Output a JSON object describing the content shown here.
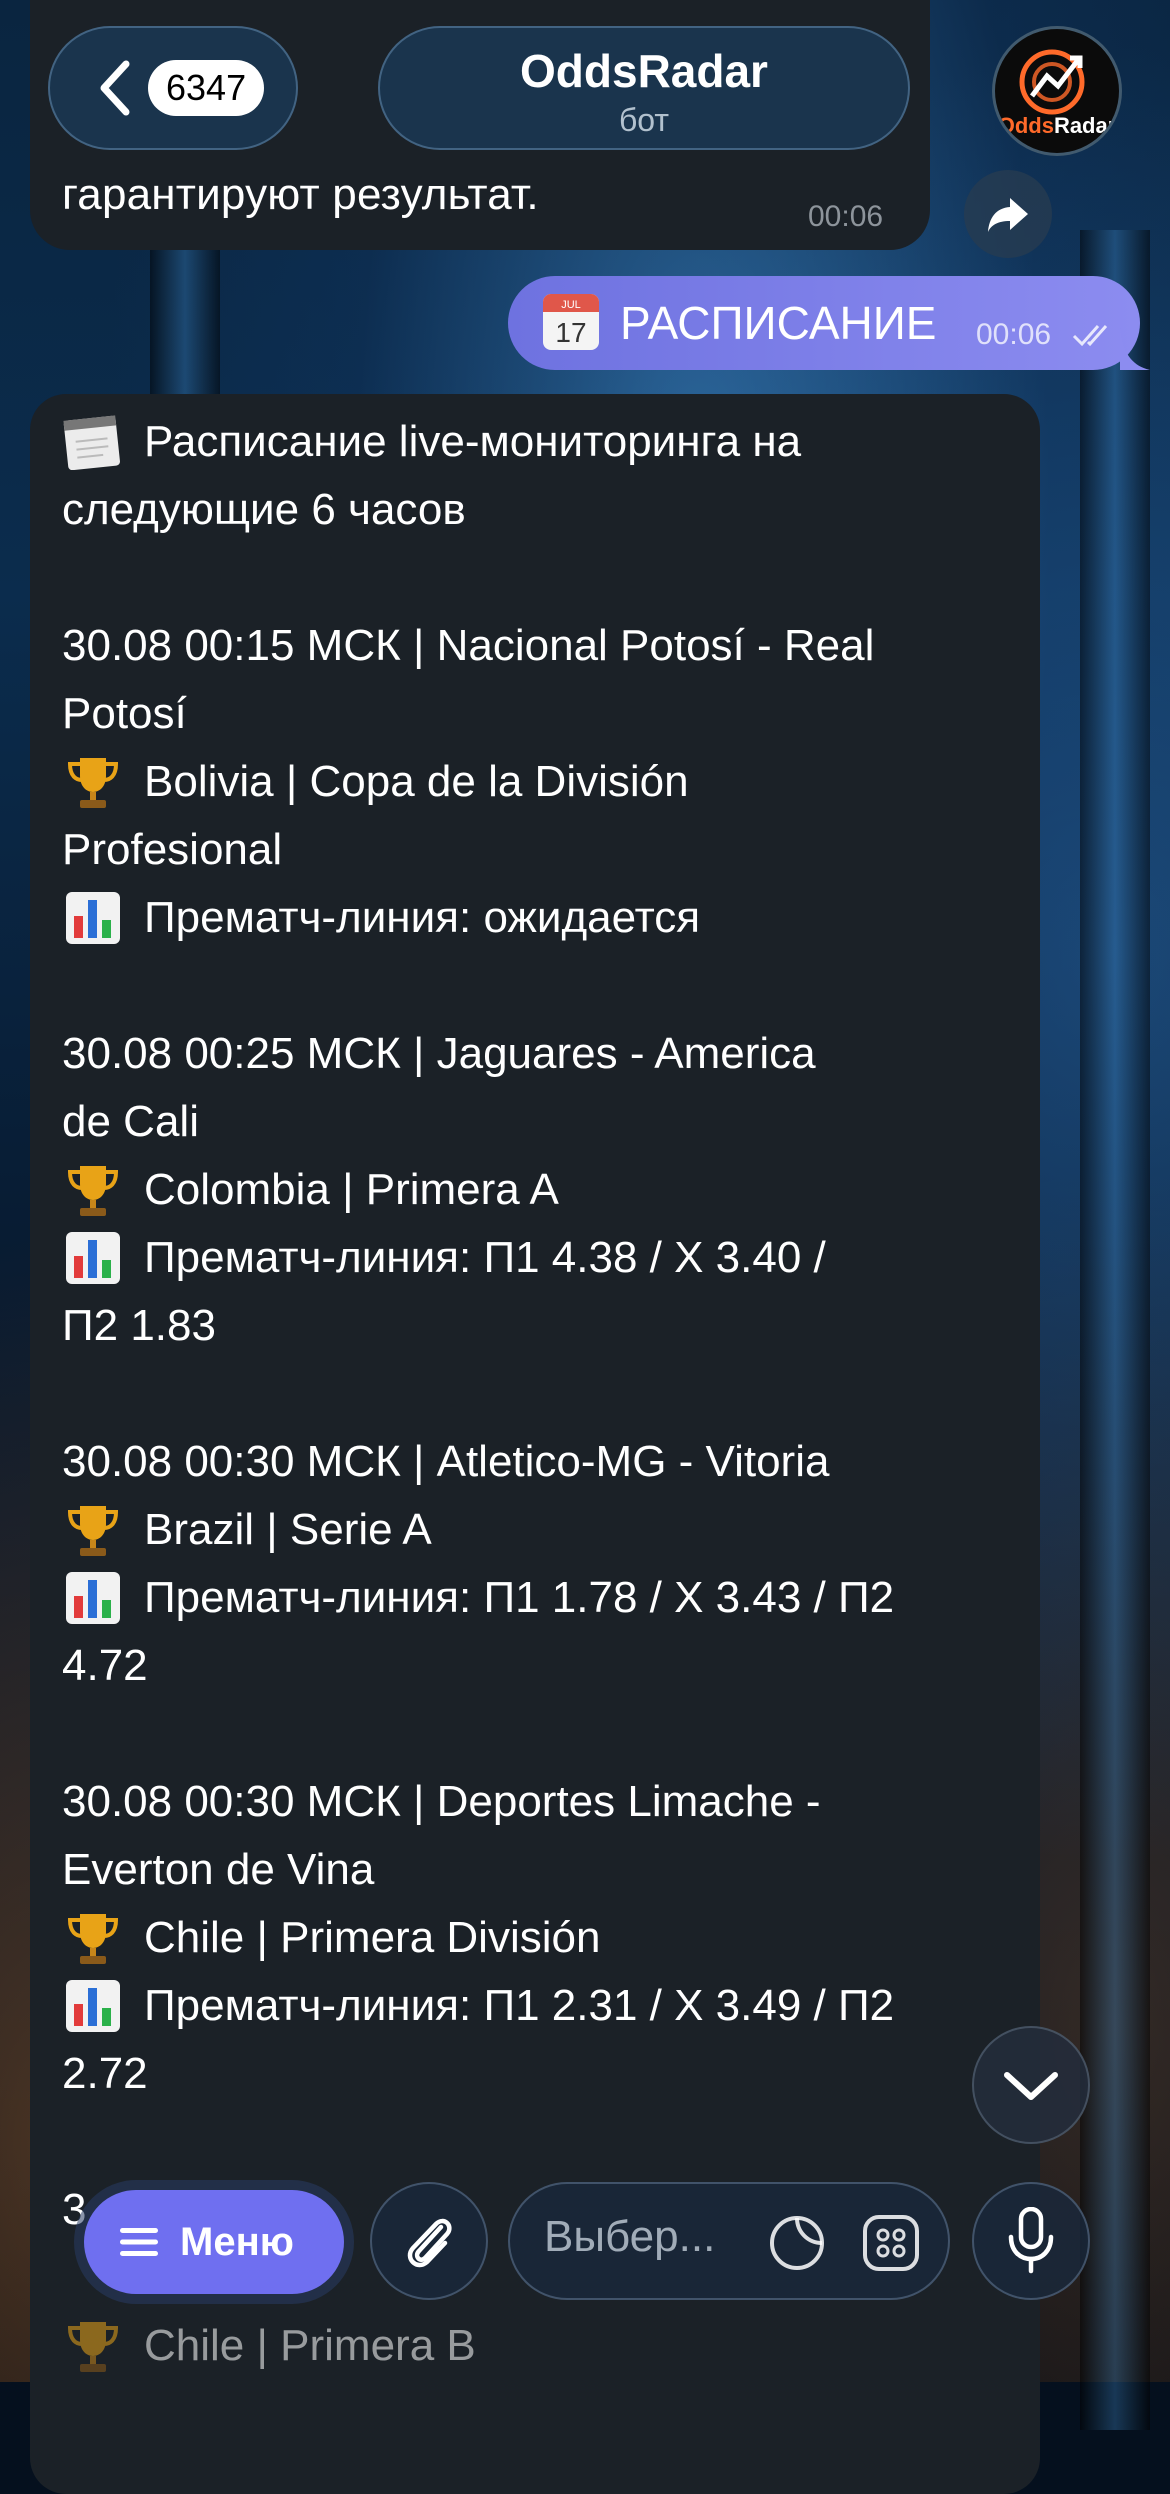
{
  "header": {
    "back_count": "6347",
    "title": "OddsRadar",
    "subtitle": "бот",
    "avatar_text": "OddsRadar"
  },
  "previous_message": {
    "text": "гарантируют результат.",
    "time": "00:06"
  },
  "outgoing_message": {
    "icon": "calendar-icon",
    "text": "РАСПИСАНИЕ",
    "time": "00:06",
    "status": "read"
  },
  "schedule": {
    "title_line1": "Расписание live-мониторинга на",
    "title_line2": "следующие 6 часов",
    "matches": [
      {
        "line1": "30.08 00:15 МСК | Nacional Potosí - Real",
        "line2": "Potosí",
        "league1": "Bolivia | Copa de la División",
        "league2": "Profesional",
        "odds1": "Прематч-линия: ожидается",
        "odds2": ""
      },
      {
        "line1": "30.08 00:25 МСК | Jaguares - America",
        "line2": "de Cali",
        "league1": "Colombia | Primera A",
        "league2": "",
        "odds1": "Прематч-линия: П1 4.38 / X 3.40 /",
        "odds2": "П2 1.83"
      },
      {
        "line1": "30.08 00:30 МСК | Atletico-MG - Vitoria",
        "line2": "",
        "league1": "Brazil | Serie A",
        "league2": "",
        "odds1": "Прематч-линия: П1 1.78 / X 3.43 / П2",
        "odds2": "4.72"
      },
      {
        "line1": "30.08 00:30 МСК | Deportes Limache -",
        "line2": "Everton de Vina",
        "league1": "Chile | Primera División",
        "league2": "",
        "odds1": "Прематч-линия: П1 2.31 / X 3.49 / П2",
        "odds2": "2.72"
      },
      {
        "line1": "3",
        "line2": "",
        "league1": "Chile | Primera B",
        "league2": "",
        "odds1": "",
        "odds2": ""
      }
    ]
  },
  "composer": {
    "menu_label": "Меню",
    "placeholder": "Выбер..."
  },
  "colors": {
    "outgoing_bubble": "#7b7ef0",
    "incoming_bubble": "#1b2127",
    "menu_button": "#6f6ff0"
  }
}
